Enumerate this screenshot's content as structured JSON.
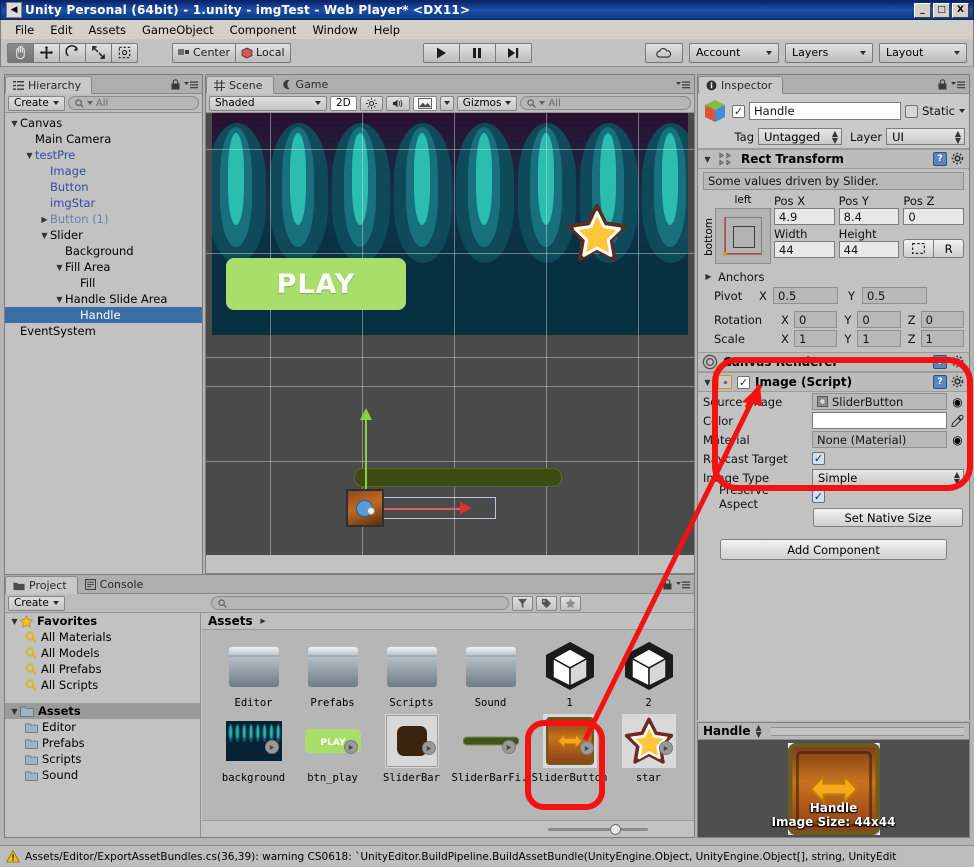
{
  "window": {
    "title": "Unity Personal (64bit) - 1.unity - imgTest - Web Player* <DX11>",
    "minimize": "_",
    "maximize": "□",
    "close": "X"
  },
  "menu": [
    "File",
    "Edit",
    "Assets",
    "GameObject",
    "Component",
    "Window",
    "Help"
  ],
  "toolbar": {
    "tools": [
      "hand-tool",
      "move-tool",
      "rotate-tool",
      "scale-tool",
      "rect-tool"
    ],
    "pivot_mode": "Center",
    "pivot_rotation": "Local",
    "play": "play-icon",
    "pause": "pause-icon",
    "step": "step-icon",
    "cloud": "cloud-icon",
    "account": "Account",
    "layers": "Layers",
    "layout": "Layout"
  },
  "hierarchy": {
    "tab": "Hierarchy",
    "create": "Create",
    "search_placeholder": "All",
    "items": [
      {
        "label": "Canvas",
        "indent": 0,
        "arrow": "down",
        "style": "normal"
      },
      {
        "label": "Main Camera",
        "indent": 1,
        "arrow": "none",
        "style": "normal"
      },
      {
        "label": "testPre",
        "indent": 1,
        "arrow": "down",
        "style": "prefab"
      },
      {
        "label": "Image",
        "indent": 2,
        "arrow": "none",
        "style": "prefab"
      },
      {
        "label": "Button",
        "indent": 2,
        "arrow": "none",
        "style": "prefab"
      },
      {
        "label": "imgStar",
        "indent": 2,
        "arrow": "none",
        "style": "prefab"
      },
      {
        "label": "Button (1)",
        "indent": 2,
        "arrow": "right",
        "style": "prefab-dim"
      },
      {
        "label": "Slider",
        "indent": 2,
        "arrow": "down",
        "style": "normal"
      },
      {
        "label": "Background",
        "indent": 3,
        "arrow": "none",
        "style": "normal"
      },
      {
        "label": "Fill Area",
        "indent": 3,
        "arrow": "down",
        "style": "normal"
      },
      {
        "label": "Fill",
        "indent": 4,
        "arrow": "none",
        "style": "normal"
      },
      {
        "label": "Handle Slide Area",
        "indent": 3,
        "arrow": "down",
        "style": "normal"
      },
      {
        "label": "Handle",
        "indent": 4,
        "arrow": "none",
        "style": "selected"
      },
      {
        "label": "EventSystem",
        "indent": 0,
        "arrow": "none",
        "style": "normal"
      }
    ]
  },
  "scene": {
    "tabs": [
      {
        "label": "Scene",
        "active": true
      },
      {
        "label": "Game",
        "active": false
      }
    ],
    "shading": "Shaded",
    "mode_2d": "2D",
    "lighting": "light-icon",
    "audio": "audio-icon",
    "effects": "image-icon",
    "gizmos": "Gizmos",
    "search_placeholder": "All",
    "play_button_label": "PLAY"
  },
  "inspector": {
    "tab": "Inspector",
    "object_name": "Handle",
    "enabled": true,
    "static_label": "Static",
    "static_checked": false,
    "tag_label": "Tag",
    "tag_value": "Untagged",
    "layer_label": "Layer",
    "layer_value": "UI",
    "rect_transform": {
      "title": "Rect Transform",
      "info": "Some values driven by Slider.",
      "anchor_top_label": "left",
      "anchor_side_label": "bottom",
      "fields": [
        {
          "label": "Pos X",
          "value": "4.9"
        },
        {
          "label": "Pos Y",
          "value": "8.4"
        },
        {
          "label": "Pos Z",
          "value": "0"
        },
        {
          "label": "Width",
          "value": "44"
        },
        {
          "label": "Height",
          "value": "44"
        }
      ],
      "blueprint_btn": "blueprint-icon",
      "raw_btn": "R",
      "anchors_label": "Anchors",
      "pivot_label": "Pivot",
      "pivot_x": "0.5",
      "pivot_y": "0.5",
      "rotation_label": "Rotation",
      "rotation_x": "0",
      "rotation_y": "0",
      "rotation_z": "0",
      "scale_label": "Scale",
      "scale_x": "1",
      "scale_y": "1",
      "scale_z": "1"
    },
    "canvas_renderer": {
      "title": "Canvas Renderer"
    },
    "image_script": {
      "title": "Image (Script)",
      "enabled": true,
      "props": [
        {
          "label": "Source Image",
          "value": "SliderButton",
          "kind": "object"
        },
        {
          "label": "Color",
          "value": "",
          "kind": "color"
        },
        {
          "label": "Material",
          "value": "None (Material)",
          "kind": "object"
        },
        {
          "label": "Raycast Target",
          "value": "",
          "kind": "check",
          "checked": true
        },
        {
          "label": "Image Type",
          "value": "Simple",
          "kind": "popup"
        },
        {
          "label": "Preserve Aspect",
          "value": "",
          "kind": "check",
          "checked": true,
          "sub": true
        }
      ],
      "set_native_size": "Set Native Size"
    },
    "add_component": "Add Component"
  },
  "project": {
    "tabs": [
      {
        "label": "Project",
        "active": true
      },
      {
        "label": "Console",
        "active": false
      }
    ],
    "create": "Create",
    "search_placeholder": "",
    "favorites_label": "Favorites",
    "favorites": [
      "All Materials",
      "All Models",
      "All Prefabs",
      "All Scripts"
    ],
    "assets_label": "Assets",
    "folders": [
      "Editor",
      "Prefabs",
      "Scripts",
      "Sound"
    ],
    "breadcrumb": "Assets",
    "items_row1": [
      {
        "name": "Editor",
        "kind": "folder"
      },
      {
        "name": "Prefabs",
        "kind": "folder"
      },
      {
        "name": "Scripts",
        "kind": "folder"
      },
      {
        "name": "Sound",
        "kind": "folder"
      },
      {
        "name": "1",
        "kind": "unity"
      },
      {
        "name": "2",
        "kind": "unity"
      }
    ],
    "items_row2": [
      {
        "name": "background",
        "kind": "tex-bg"
      },
      {
        "name": "btn_play",
        "kind": "tex-play"
      },
      {
        "name": "SliderBar",
        "kind": "tex-bar"
      },
      {
        "name": "SliderBarFi...",
        "kind": "tex-fill"
      },
      {
        "name": "SliderButton",
        "kind": "tex-handle",
        "selected": true
      },
      {
        "name": "star",
        "kind": "tex-star"
      }
    ]
  },
  "preview": {
    "title": "Handle",
    "label": "Handle",
    "size_label": "Image Size: 44x44"
  },
  "status": {
    "icon": "warning-icon",
    "message": "Assets/Editor/ExportAssetBundles.cs(36,39): warning CS0618: `UnityEditor.BuildPipeline.BuildAssetBundle(UnityEngine.Object, UnityEngine.Object[], string, UnityEdit"
  },
  "colors": {
    "accent_blue": "#3a6ea5",
    "annotation_red": "#f21212",
    "selection_blue": "#3a6ea5",
    "prefab_blue": "#2f4f9e",
    "play_green": "#a8de6c",
    "star_yellow": "#ffc83c"
  }
}
